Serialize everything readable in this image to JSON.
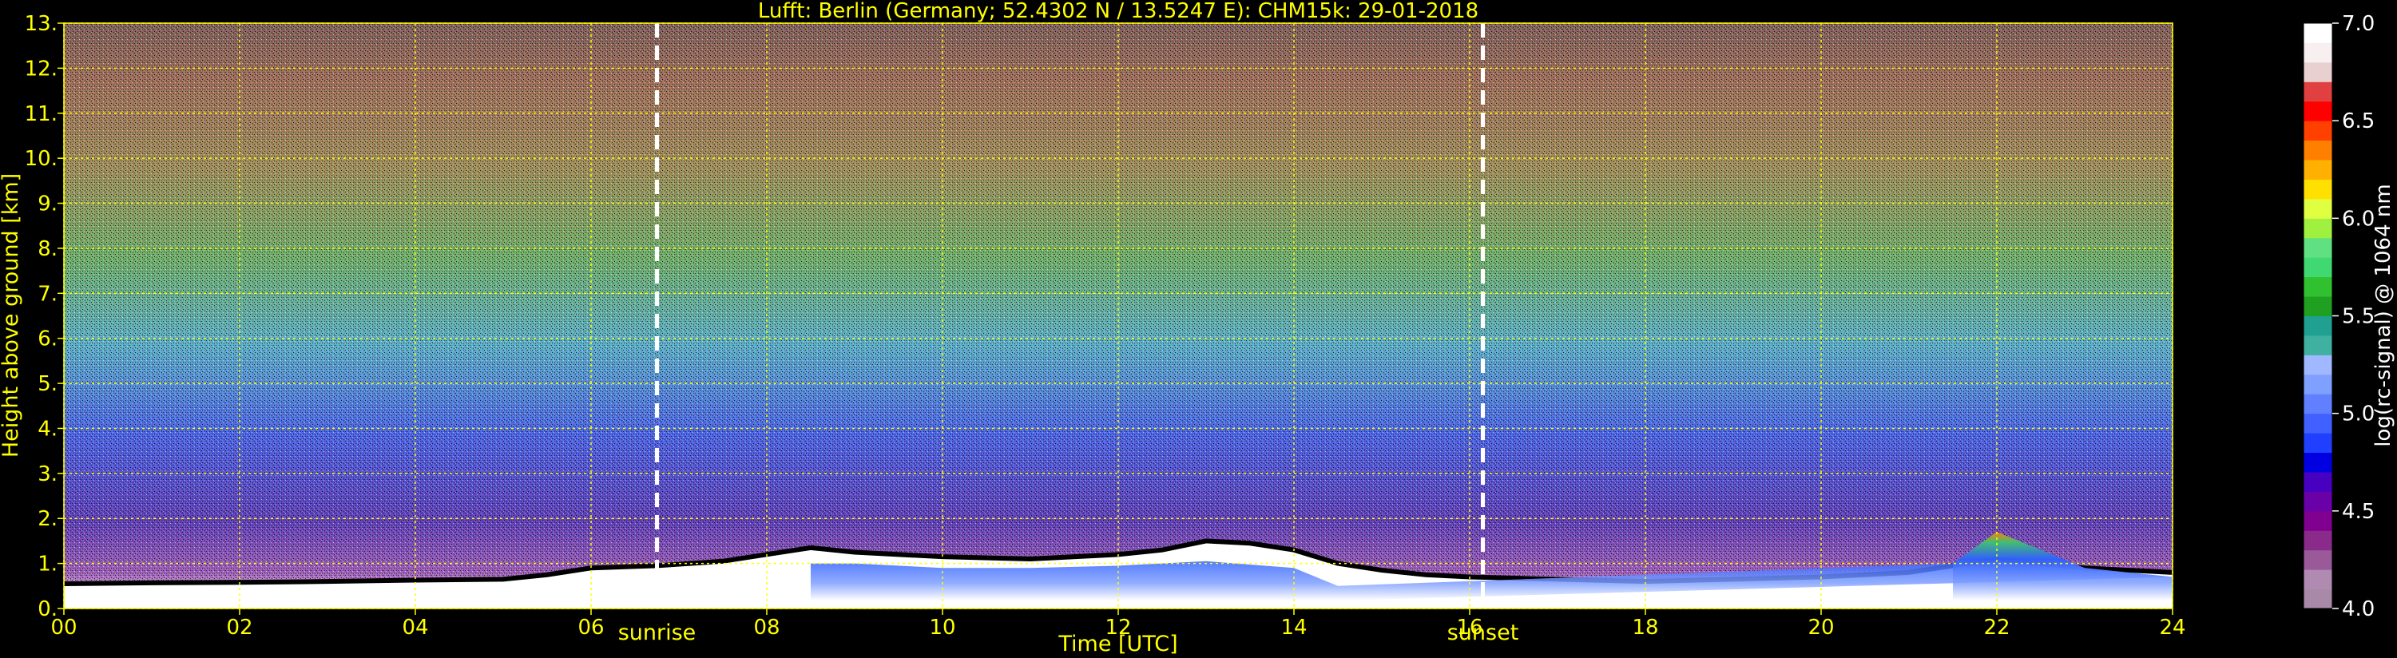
{
  "chart_data": {
    "type": "heatmap",
    "title": "Lufft: Berlin (Germany; 52.4302 N / 13.5247 E):    CHM15k: 29-01-2018",
    "xlabel": "Time [UTC]",
    "ylabel": "Height above ground [km]",
    "xlim": [
      0,
      24
    ],
    "ylim": [
      0,
      13
    ],
    "x_ticks": [
      "00",
      "02",
      "04",
      "06",
      "08",
      "10",
      "12",
      "14",
      "16",
      "18",
      "20",
      "22",
      "24"
    ],
    "y_ticks": [
      "0.",
      "1.",
      "2.",
      "3.",
      "4.",
      "5.",
      "6.",
      "7.",
      "8.",
      "9.",
      "10.",
      "11.",
      "12.",
      "13."
    ],
    "grid": true,
    "events": [
      {
        "label": "sunrise",
        "time": 6.75
      },
      {
        "label": "sunset",
        "time": 16.15
      }
    ],
    "colorbar": {
      "label": "log(rc-signal) @ 1064 nm",
      "range": [
        4.0,
        7.0
      ],
      "ticks": [
        "4.0",
        "4.5",
        "5.0",
        "5.5",
        "6.0",
        "6.5",
        "7.0"
      ],
      "colors": [
        "#a88aa8",
        "#b08ab0",
        "#9a5a9a",
        "#8a2a8a",
        "#800090",
        "#6a00a8",
        "#4800c0",
        "#0000e0",
        "#2040ff",
        "#4060ff",
        "#6080ff",
        "#80a0ff",
        "#a0b8ff",
        "#40b0a0",
        "#20a090",
        "#20a020",
        "#30c030",
        "#40d870",
        "#60e080",
        "#a0f040",
        "#e0ff40",
        "#ffe000",
        "#ffb000",
        "#ff8000",
        "#ff4000",
        "#ff0000",
        "#e04040",
        "#e8d0d0",
        "#f8f0f0",
        "#ffffff"
      ]
    },
    "boundary_layer_top_km": [
      [
        0,
        0.55
      ],
      [
        1,
        0.57
      ],
      [
        2,
        0.58
      ],
      [
        3,
        0.6
      ],
      [
        4,
        0.63
      ],
      [
        5,
        0.65
      ],
      [
        5.5,
        0.75
      ],
      [
        6,
        0.9
      ],
      [
        6.75,
        0.95
      ],
      [
        7.5,
        1.05
      ],
      [
        8,
        1.2
      ],
      [
        8.5,
        1.35
      ],
      [
        9,
        1.25
      ],
      [
        10,
        1.15
      ],
      [
        11,
        1.1
      ],
      [
        12,
        1.2
      ],
      [
        12.5,
        1.3
      ],
      [
        13,
        1.5
      ],
      [
        13.5,
        1.45
      ],
      [
        14,
        1.3
      ],
      [
        14.5,
        1.0
      ],
      [
        15,
        0.85
      ],
      [
        15.5,
        0.75
      ],
      [
        16,
        0.7
      ],
      [
        17,
        0.65
      ],
      [
        18,
        0.6
      ],
      [
        19,
        0.65
      ],
      [
        20,
        0.7
      ],
      [
        21,
        0.8
      ],
      [
        22,
        1.1
      ],
      [
        23,
        0.9
      ],
      [
        24,
        0.8
      ]
    ],
    "aerosol_layer_km": [
      [
        8.5,
        1.0
      ],
      [
        9,
        1.0
      ],
      [
        10,
        0.9
      ],
      [
        11,
        0.9
      ],
      [
        12,
        0.95
      ],
      [
        13,
        1.05
      ],
      [
        14,
        0.9
      ],
      [
        14.5,
        0.5
      ],
      [
        21.5,
        1.0
      ],
      [
        22,
        1.7
      ],
      [
        23,
        0.9
      ],
      [
        24,
        0.7
      ]
    ]
  }
}
